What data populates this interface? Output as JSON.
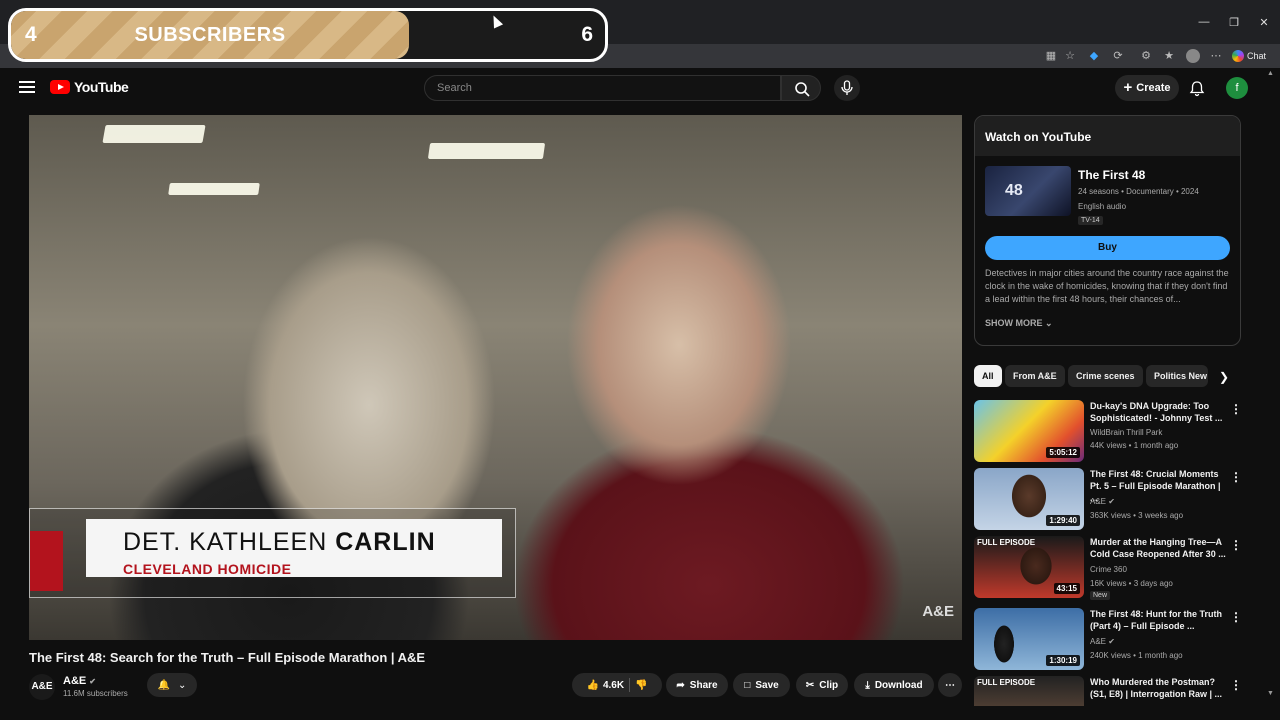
{
  "overlay": {
    "left_count": "4",
    "label": "SUBSCRIBERS",
    "right_count": "6",
    "progress_fraction": 0.67
  },
  "browser": {
    "chat_label": "Chat",
    "window_controls": [
      "minimize-icon",
      "restore-icon",
      "close-icon"
    ]
  },
  "header": {
    "logo_text": "YouTube",
    "search_placeholder": "Search",
    "create_label": "Create",
    "avatar_letter": "f"
  },
  "video": {
    "lower_third_first": "DET. KATHLEEN ",
    "lower_third_last": "CARLIN",
    "lower_third_subtitle": "CLEVELAND HOMICIDE",
    "network_bug": "A&E",
    "title": "The First 48: Search for the Truth – Full Episode Marathon | A&E"
  },
  "channel": {
    "logo": "A&E",
    "name": "A&E",
    "subscribers": "11.6M subscribers"
  },
  "actions": {
    "likes": "4.6K",
    "share": "Share",
    "save": "Save",
    "clip": "Clip",
    "download": "Download"
  },
  "panel": {
    "heading": "Watch on YouTube",
    "show_title": "The First 48",
    "thumb_text": "48",
    "meta": "24 seasons • Documentary • 2024",
    "audio": "English audio",
    "rating": "TV-14",
    "buy_label": "Buy",
    "description": "Detectives in major cities around the country race against the clock in the wake of homicides, knowing that if they don't find a lead within the first 48 hours, their chances of...",
    "show_more": "SHOW MORE"
  },
  "chips": [
    "All",
    "From A&E",
    "Crime scenes",
    "Politics New"
  ],
  "recommendations": [
    {
      "title": "Du-kay's DNA Upgrade: Too Sophisticated! - Johnny Test ...",
      "channel": "WildBrain Thrill Park",
      "views": "44K views • 1 month ago",
      "duration": "5:05:12",
      "tag": "",
      "badge": ""
    },
    {
      "title": "The First 48: Crucial Moments Pt. 5 – Full Episode Marathon | ...",
      "channel": "A&E",
      "views": "363K views • 3 weeks ago",
      "duration": "1:29:40",
      "tag": "",
      "badge": ""
    },
    {
      "title": "Murder at the Hanging Tree—A Cold Case Reopened After 30 ...",
      "channel": "Crime 360",
      "views": "16K views • 3 days ago",
      "duration": "43:15",
      "tag": "FULL EPISODE",
      "badge": "New"
    },
    {
      "title": "The First 48: Hunt for the Truth (Part 4) – Full Episode ...",
      "channel": "A&E",
      "views": "240K views • 1 month ago",
      "duration": "1:30:19",
      "tag": "",
      "badge": ""
    },
    {
      "title": "Who Murdered the Postman? (S1, E8) | Interrogation Raw | ...",
      "channel": "",
      "views": "",
      "duration": "",
      "tag": "FULL EPISODE",
      "badge": ""
    }
  ],
  "colors": {
    "background": "#0f0f0f",
    "brand_red": "#ff0000",
    "buy_blue": "#3ea6ff",
    "overlay_gold": "#c9a46e"
  }
}
